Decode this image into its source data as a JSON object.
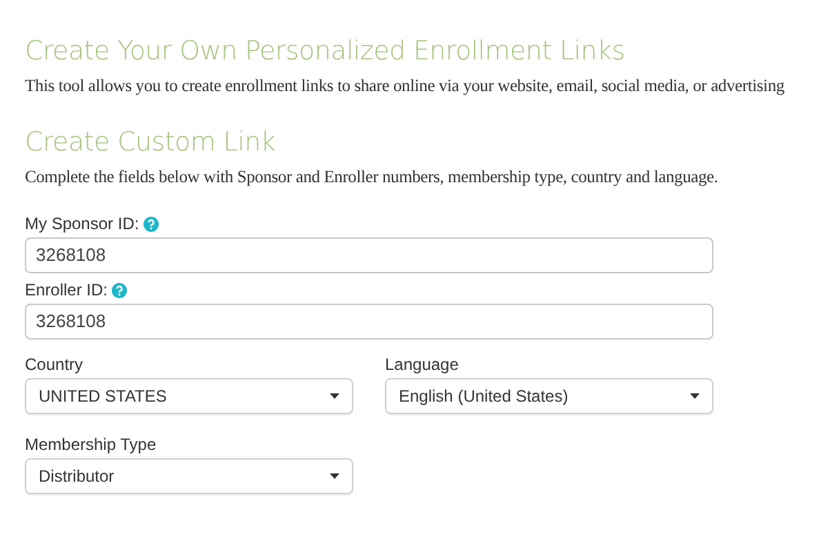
{
  "sections": [
    {
      "title": "Create Your Own Personalized Enrollment Links",
      "description": "This tool allows you to create enrollment links to share online via your website, email, social media, or advertising"
    },
    {
      "title": "Create Custom Link",
      "description": "Complete the fields below with Sponsor and Enroller numbers, membership type, country and language."
    }
  ],
  "fields": [
    {
      "kind": "text",
      "label": "My Sponsor ID:",
      "help": true,
      "value": "3268108"
    },
    {
      "kind": "text",
      "label": "Enroller ID:",
      "help": true,
      "value": "3268108"
    },
    {
      "kind": "select",
      "label": "Country",
      "help": false,
      "value": "UNITED STATES"
    },
    {
      "kind": "select",
      "label": "Language",
      "help": false,
      "value": "English (United States)"
    },
    {
      "kind": "select",
      "label": "Membership Type",
      "help": false,
      "value": "Distributor"
    }
  ]
}
